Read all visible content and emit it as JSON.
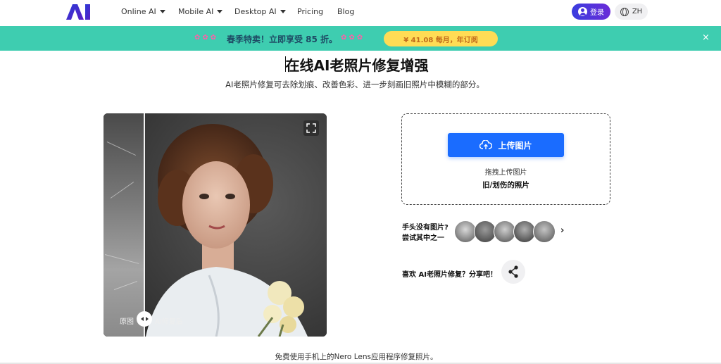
{
  "nav": {
    "logo_text": "AI",
    "items": [
      {
        "label": "Online AI",
        "has_dropdown": true
      },
      {
        "label": "Mobile AI",
        "has_dropdown": true
      },
      {
        "label": "Desktop AI",
        "has_dropdown": true
      },
      {
        "label": "Pricing",
        "has_dropdown": false
      },
      {
        "label": "Blog",
        "has_dropdown": false
      }
    ],
    "login_label": "登录",
    "language_label": "ZH"
  },
  "banner": {
    "promo_text": "春季特卖！立即享受 85 折。",
    "offer_button": "¥ 41.08 每月，年订阅",
    "close_icon": "×"
  },
  "header": {
    "title": "在线AI老照片修复增强",
    "subtitle": "AI老照片修复可去除划痕、改善色彩、进一步刻画旧照片中模糊的部分。"
  },
  "compare": {
    "before_label": "原图",
    "after_label": "AI修复后"
  },
  "upload": {
    "button_label": "上传图片",
    "drag_text": "拖拽上传图片",
    "sub_text": "旧/划伤的照片"
  },
  "samples": {
    "question_line1": "手头没有图片?",
    "question_line2": "尝试其中之一"
  },
  "share": {
    "text": "喜欢 AI老照片修复？分享吧！"
  },
  "footer": {
    "text": "免费使用手机上的Nero Lens应用程序修复照片。"
  },
  "colors": {
    "brand": "#3a3dde",
    "banner_bg": "#3ecdb0",
    "upload_button": "#1a6cff",
    "offer_button": "#ffdc55"
  }
}
